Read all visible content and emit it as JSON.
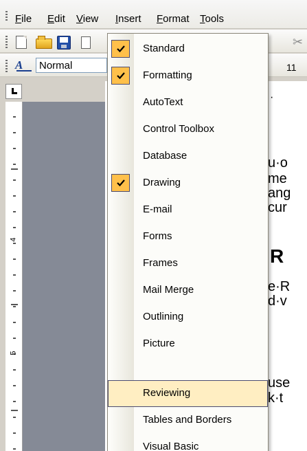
{
  "menubar": {
    "items": [
      "File",
      "Edit",
      "View",
      "Insert",
      "Format",
      "Tools"
    ]
  },
  "formatting": {
    "style_value": "Normal",
    "font_size_partial": "11"
  },
  "toolbars_menu": {
    "items": [
      {
        "label": "Standard",
        "checked": true
      },
      {
        "label": "Formatting",
        "checked": true
      },
      {
        "label": "AutoText",
        "checked": false
      },
      {
        "label": "Control Toolbox",
        "checked": false
      },
      {
        "label": "Database",
        "checked": false
      },
      {
        "label": "Drawing",
        "checked": true
      },
      {
        "label": "E-mail",
        "checked": false
      },
      {
        "label": "Forms",
        "checked": false
      },
      {
        "label": "Frames",
        "checked": false
      },
      {
        "label": "Mail Merge",
        "checked": false
      },
      {
        "label": "Outlining",
        "checked": false
      },
      {
        "label": "Picture",
        "checked": false
      },
      {
        "label": "Reviewing",
        "checked": false,
        "highlighted": true
      },
      {
        "label": "Tables and Borders",
        "checked": false
      },
      {
        "label": "Visual Basic",
        "checked": false
      }
    ]
  },
  "ruler": {
    "labels": [
      "4",
      "5"
    ]
  },
  "document": {
    "fragments": [
      "·",
      "u·o",
      "me",
      "ang",
      "cur",
      "R",
      "e·R",
      "d·v",
      "use",
      "k·t"
    ]
  },
  "colors": {
    "menu_highlight": "#ffeec2",
    "check_fill": "#ffc04a",
    "menu_border": "#4b4b6f"
  }
}
